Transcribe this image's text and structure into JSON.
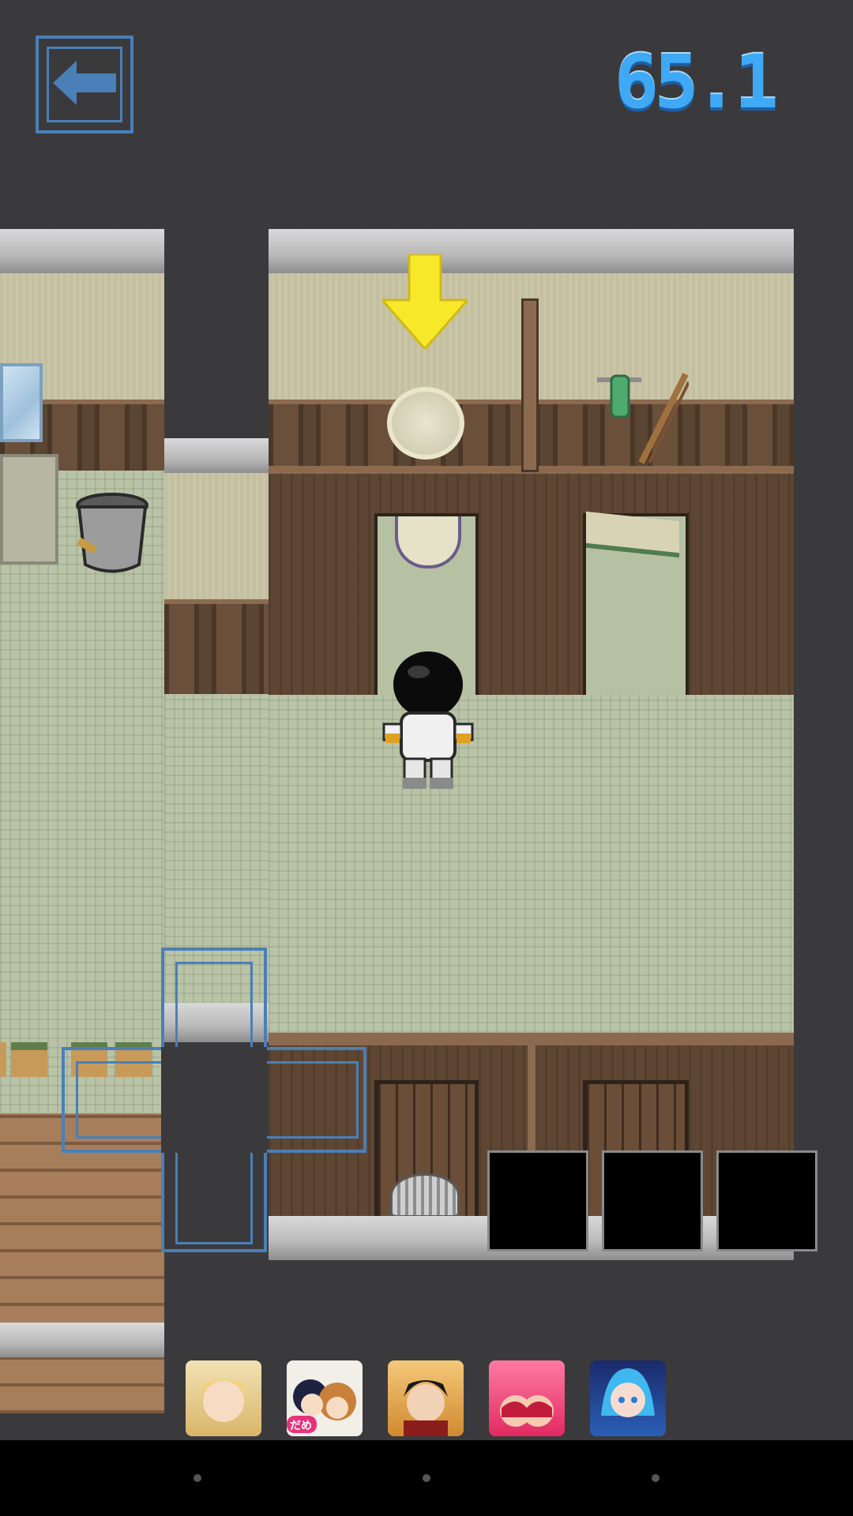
{
  "hud": {
    "timer": "65.1",
    "back_icon": "arrow-left-icon"
  },
  "hint": {
    "icon": "down-arrow-icon",
    "color": "#f7e92a"
  },
  "dpad": {
    "icon": "dpad-icon",
    "color": "#4a7fb8"
  },
  "inventory": {
    "slots": [
      "",
      "",
      ""
    ]
  },
  "ads": [
    {
      "icon": "ad-blonde-man-icon"
    },
    {
      "icon": "ad-anime-girls-icon",
      "badge": "だめ"
    },
    {
      "icon": "ad-dark-haired-man-icon"
    },
    {
      "icon": "ad-red-bikini-icon"
    },
    {
      "icon": "ad-blue-fairy-icon"
    }
  ],
  "navigation": {
    "buttons": [
      "back",
      "home",
      "recents"
    ]
  }
}
